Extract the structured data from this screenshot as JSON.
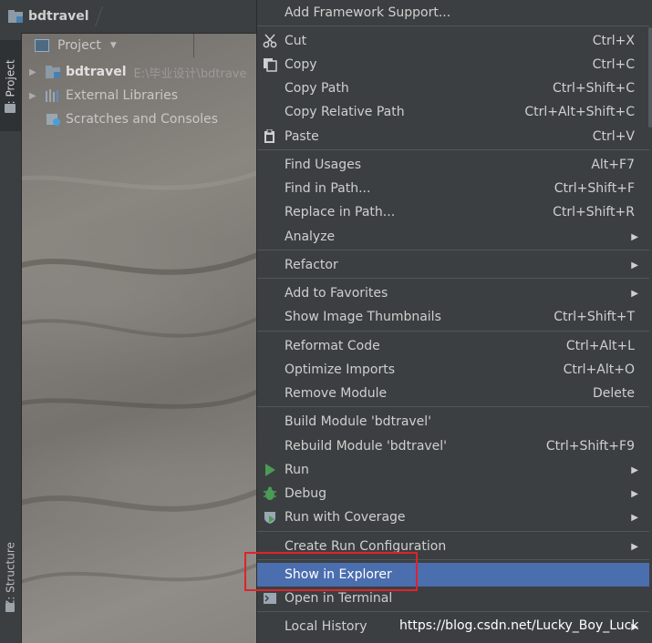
{
  "navbar": {
    "title": "bdtravel"
  },
  "side_tabs": {
    "project": "1: Project",
    "structure": "Z: Structure"
  },
  "project_panel": {
    "header_label": "Project",
    "tree": [
      {
        "label": "bdtravel",
        "path": "E:\\毕业设计\\bdtrave"
      },
      {
        "label": "External Libraries"
      },
      {
        "label": "Scratches and Consoles"
      }
    ]
  },
  "context_menu": {
    "items": [
      {
        "label": "Add Framework Support...",
        "shortcut": ""
      },
      {
        "label": "Cut",
        "shortcut": "Ctrl+X",
        "icon": "scissors-icon"
      },
      {
        "label": "Copy",
        "shortcut": "Ctrl+C",
        "icon": "copy-icon"
      },
      {
        "label": "Copy Path",
        "shortcut": "Ctrl+Shift+C"
      },
      {
        "label": "Copy Relative Path",
        "shortcut": "Ctrl+Alt+Shift+C"
      },
      {
        "label": "Paste",
        "shortcut": "Ctrl+V",
        "icon": "clipboard-icon"
      },
      {
        "label": "Find Usages",
        "shortcut": "Alt+F7"
      },
      {
        "label": "Find in Path...",
        "shortcut": "Ctrl+Shift+F"
      },
      {
        "label": "Replace in Path...",
        "shortcut": "Ctrl+Shift+R"
      },
      {
        "label": "Analyze",
        "shortcut": "",
        "submenu": true
      },
      {
        "label": "Refactor",
        "shortcut": "",
        "submenu": true
      },
      {
        "label": "Add to Favorites",
        "shortcut": "",
        "submenu": true
      },
      {
        "label": "Show Image Thumbnails",
        "shortcut": "Ctrl+Shift+T"
      },
      {
        "label": "Reformat Code",
        "shortcut": "Ctrl+Alt+L"
      },
      {
        "label": "Optimize Imports",
        "shortcut": "Ctrl+Alt+O"
      },
      {
        "label": "Remove Module",
        "shortcut": "Delete"
      },
      {
        "label": "Build Module 'bdtravel'",
        "shortcut": ""
      },
      {
        "label": "Rebuild Module 'bdtravel'",
        "shortcut": "Ctrl+Shift+F9"
      },
      {
        "label": "Run",
        "shortcut": "",
        "submenu": true,
        "icon": "run-icon"
      },
      {
        "label": "Debug",
        "shortcut": "",
        "submenu": true,
        "icon": "debug-icon"
      },
      {
        "label": "Run with Coverage",
        "shortcut": "",
        "submenu": true,
        "icon": "coverage-icon"
      },
      {
        "label": "Create Run Configuration",
        "shortcut": "",
        "submenu": true
      },
      {
        "label": "Show in Explorer",
        "shortcut": "",
        "selected": true
      },
      {
        "label": "Open in Terminal",
        "shortcut": "",
        "icon": "terminal-icon"
      },
      {
        "label": "Local History",
        "shortcut": "",
        "submenu": true
      }
    ]
  },
  "watermark": "https://blog.csdn.net/Lucky_Boy_Luck",
  "colors": {
    "selection": "#4b6eaf",
    "menu_bg": "#3c3f41",
    "highlight_box": "#e0222b"
  }
}
